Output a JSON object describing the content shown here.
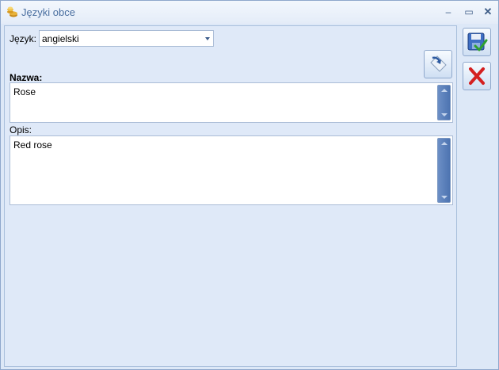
{
  "window": {
    "title": "Języki obce",
    "minimize_glyph": "‒",
    "maximize_glyph": "▭",
    "close_glyph": "✕"
  },
  "form": {
    "language_label": "Język:",
    "language_value": "angielski",
    "name_label": "Nazwa:",
    "name_value": "Rose",
    "description_label": "Opis:",
    "description_value": "Red rose"
  },
  "icons": {
    "title": "coins-icon",
    "copy": "copy-arrow-icon",
    "save": "save-icon",
    "cancel": "cancel-icon"
  },
  "colors": {
    "window_bg": "#dde8f7",
    "title_text": "#4a6fa0",
    "scrollbar": "#5a7fbb",
    "save_check": "#2ea02e",
    "cancel_x": "#d42020"
  }
}
